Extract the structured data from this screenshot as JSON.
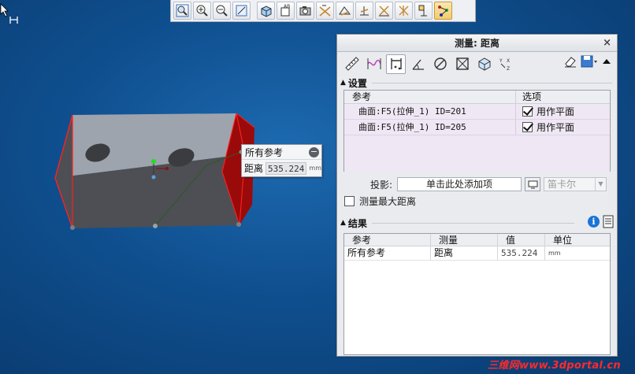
{
  "dialog": {
    "title": "测量: 距离",
    "close_label": "×"
  },
  "settings": {
    "heading": "设置",
    "col_reference": "参考",
    "col_options": "选项",
    "rows": [
      {
        "reference": "曲面:F5(拉伸_1) ID=201",
        "option": "用作平面",
        "checked": true
      },
      {
        "reference": "曲面:F5(拉伸_1) ID=205",
        "option": "用作平面",
        "checked": true
      }
    ],
    "projection_label": "投影:",
    "projection_input": "单击此处添加项",
    "projection_select": "笛卡尔",
    "measure_max_label": "测量最大距离"
  },
  "results": {
    "heading": "结果",
    "columns": [
      "参考",
      "测量",
      "值",
      "单位"
    ],
    "rows": [
      {
        "reference": "所有参考",
        "measure": "距离",
        "value": "535.224",
        "unit": "mm"
      }
    ]
  },
  "floating": {
    "header": "所有参考",
    "label": "距离",
    "value": "535.224",
    "unit": "mm"
  },
  "watermark": "三维网www.3dportal.cn",
  "colors": {
    "viewport_bg": "#0f4f8f",
    "selected_face": "#9b0a0a",
    "accent_info": "#1a73d9"
  }
}
